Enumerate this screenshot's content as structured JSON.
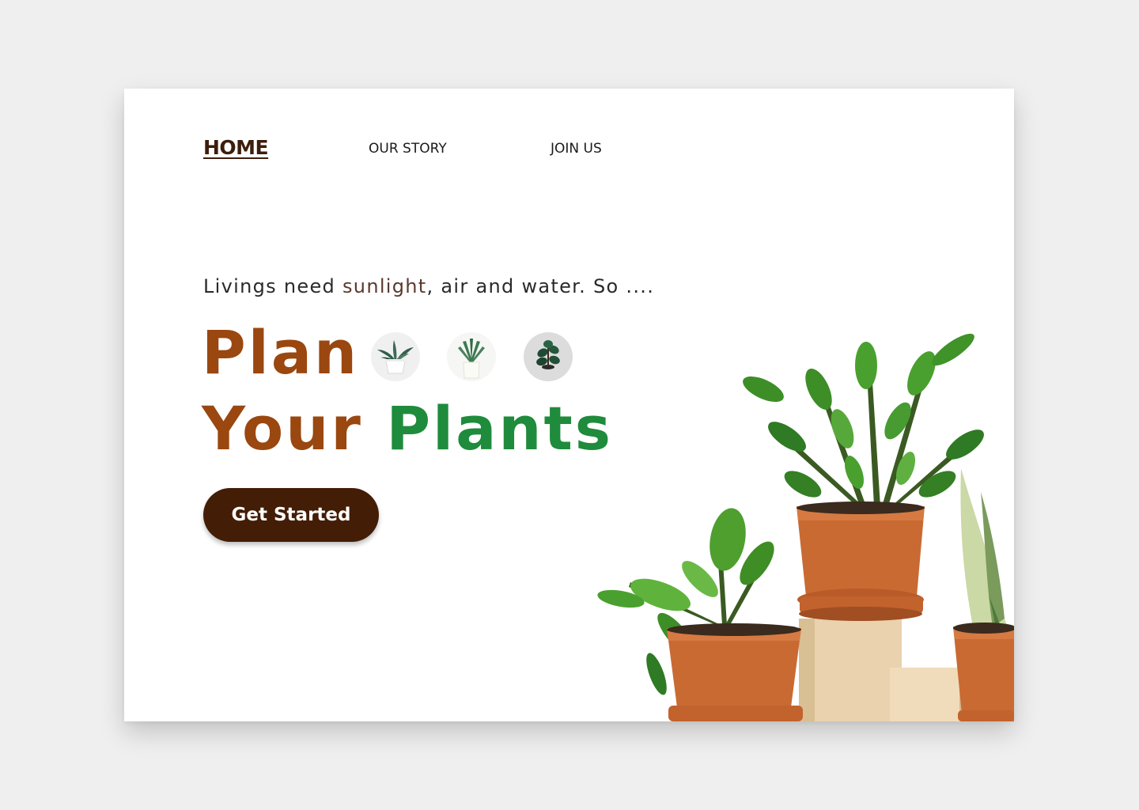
{
  "nav": {
    "home": "HOME",
    "story": "OUR STORY",
    "join": "JOIN US"
  },
  "hero": {
    "tagline_before": "Livings need ",
    "tagline_highlight": "sunlight",
    "tagline_after": ", air and water. So ....",
    "headline_line1": "Plan",
    "headline_your": "Your",
    "headline_plants": "Plants",
    "cta_label": "Get Started"
  },
  "thumbnails": [
    {
      "icon": "snake-plant-white-pot-icon"
    },
    {
      "icon": "aloe-white-pot-icon"
    },
    {
      "icon": "fiddle-leaf-fig-icon"
    }
  ],
  "colors": {
    "brand_brown": "#9a4710",
    "brand_green": "#1f8b3c",
    "button_dark_brown": "#431d05",
    "nav_active": "#3d1d0c"
  }
}
